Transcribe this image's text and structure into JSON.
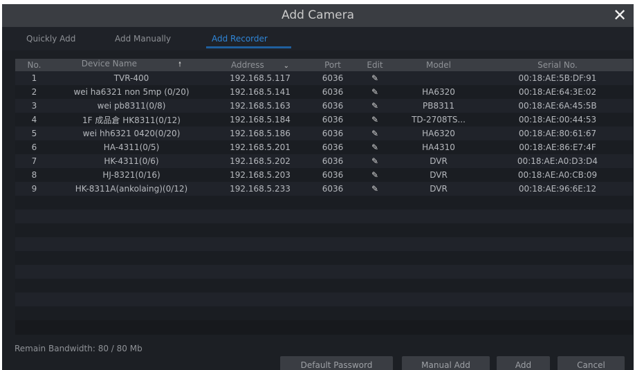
{
  "window": {
    "title": "Add Camera",
    "caption_above": ""
  },
  "icons": {
    "close": "close-icon",
    "sort_asc": "arrow-up-icon",
    "sort_dropdown": "chevron-down-icon",
    "edit": "pencil-icon"
  },
  "tabs": [
    {
      "label": "Quickly Add",
      "active": false
    },
    {
      "label": "Add Manually",
      "active": false
    },
    {
      "label": "Add Recorder",
      "active": true
    }
  ],
  "table": {
    "columns": [
      "No.",
      "Device Name",
      "Address",
      "Port",
      "Edit",
      "Model",
      "Serial No."
    ],
    "rows": [
      {
        "no": "1",
        "name": "TVR-400",
        "address": "192.168.5.117",
        "port": "6036",
        "model": "",
        "serial": "00:18:AE:5B:DF:91"
      },
      {
        "no": "2",
        "name": "wei ha6321 non 5mp (0/20)",
        "address": "192.168.5.141",
        "port": "6036",
        "model": "HA6320",
        "serial": "00:18:AE:64:3E:02"
      },
      {
        "no": "3",
        "name": "wei pb8311(0/8)",
        "address": "192.168.5.163",
        "port": "6036",
        "model": "PB8311",
        "serial": "00:18:AE:6A:45:5B"
      },
      {
        "no": "4",
        "name": "1F 成品倉 HK8311(0/12)",
        "address": "192.168.5.184",
        "port": "6036",
        "model": "TD-2708TS...",
        "serial": "00:18:AE:00:44:53"
      },
      {
        "no": "5",
        "name": "wei hh6321 0420(0/20)",
        "address": "192.168.5.186",
        "port": "6036",
        "model": "HA6320",
        "serial": "00:18:AE:80:61:67"
      },
      {
        "no": "6",
        "name": "HA-4311(0/5)",
        "address": "192.168.5.201",
        "port": "6036",
        "model": "HA4310",
        "serial": "00:18:AE:86:E7:4F"
      },
      {
        "no": "7",
        "name": "HK-4311(0/6)",
        "address": "192.168.5.202",
        "port": "6036",
        "model": "DVR",
        "serial": "00:18:AE:A0:D3:D4"
      },
      {
        "no": "8",
        "name": "HJ-8321(0/16)",
        "address": "192.168.5.203",
        "port": "6036",
        "model": "DVR",
        "serial": "00:18:AE:A0:CB:09"
      },
      {
        "no": "9",
        "name": "HK-8311A(ankolaing)(0/12)",
        "address": "192.168.5.233",
        "port": "6036",
        "model": "DVR",
        "serial": "00:18:AE:96:6E:12"
      }
    ]
  },
  "footer": {
    "bandwidth": "Remain Bandwidth: 80 / 80 Mb",
    "buttons": {
      "default_password": "Default Password",
      "manual_add": "Manual Add",
      "add": "Add",
      "cancel": "Cancel"
    }
  },
  "colors": {
    "accent": "#2f86d8",
    "background": "#1c1f24",
    "header": "#3b3e44"
  }
}
